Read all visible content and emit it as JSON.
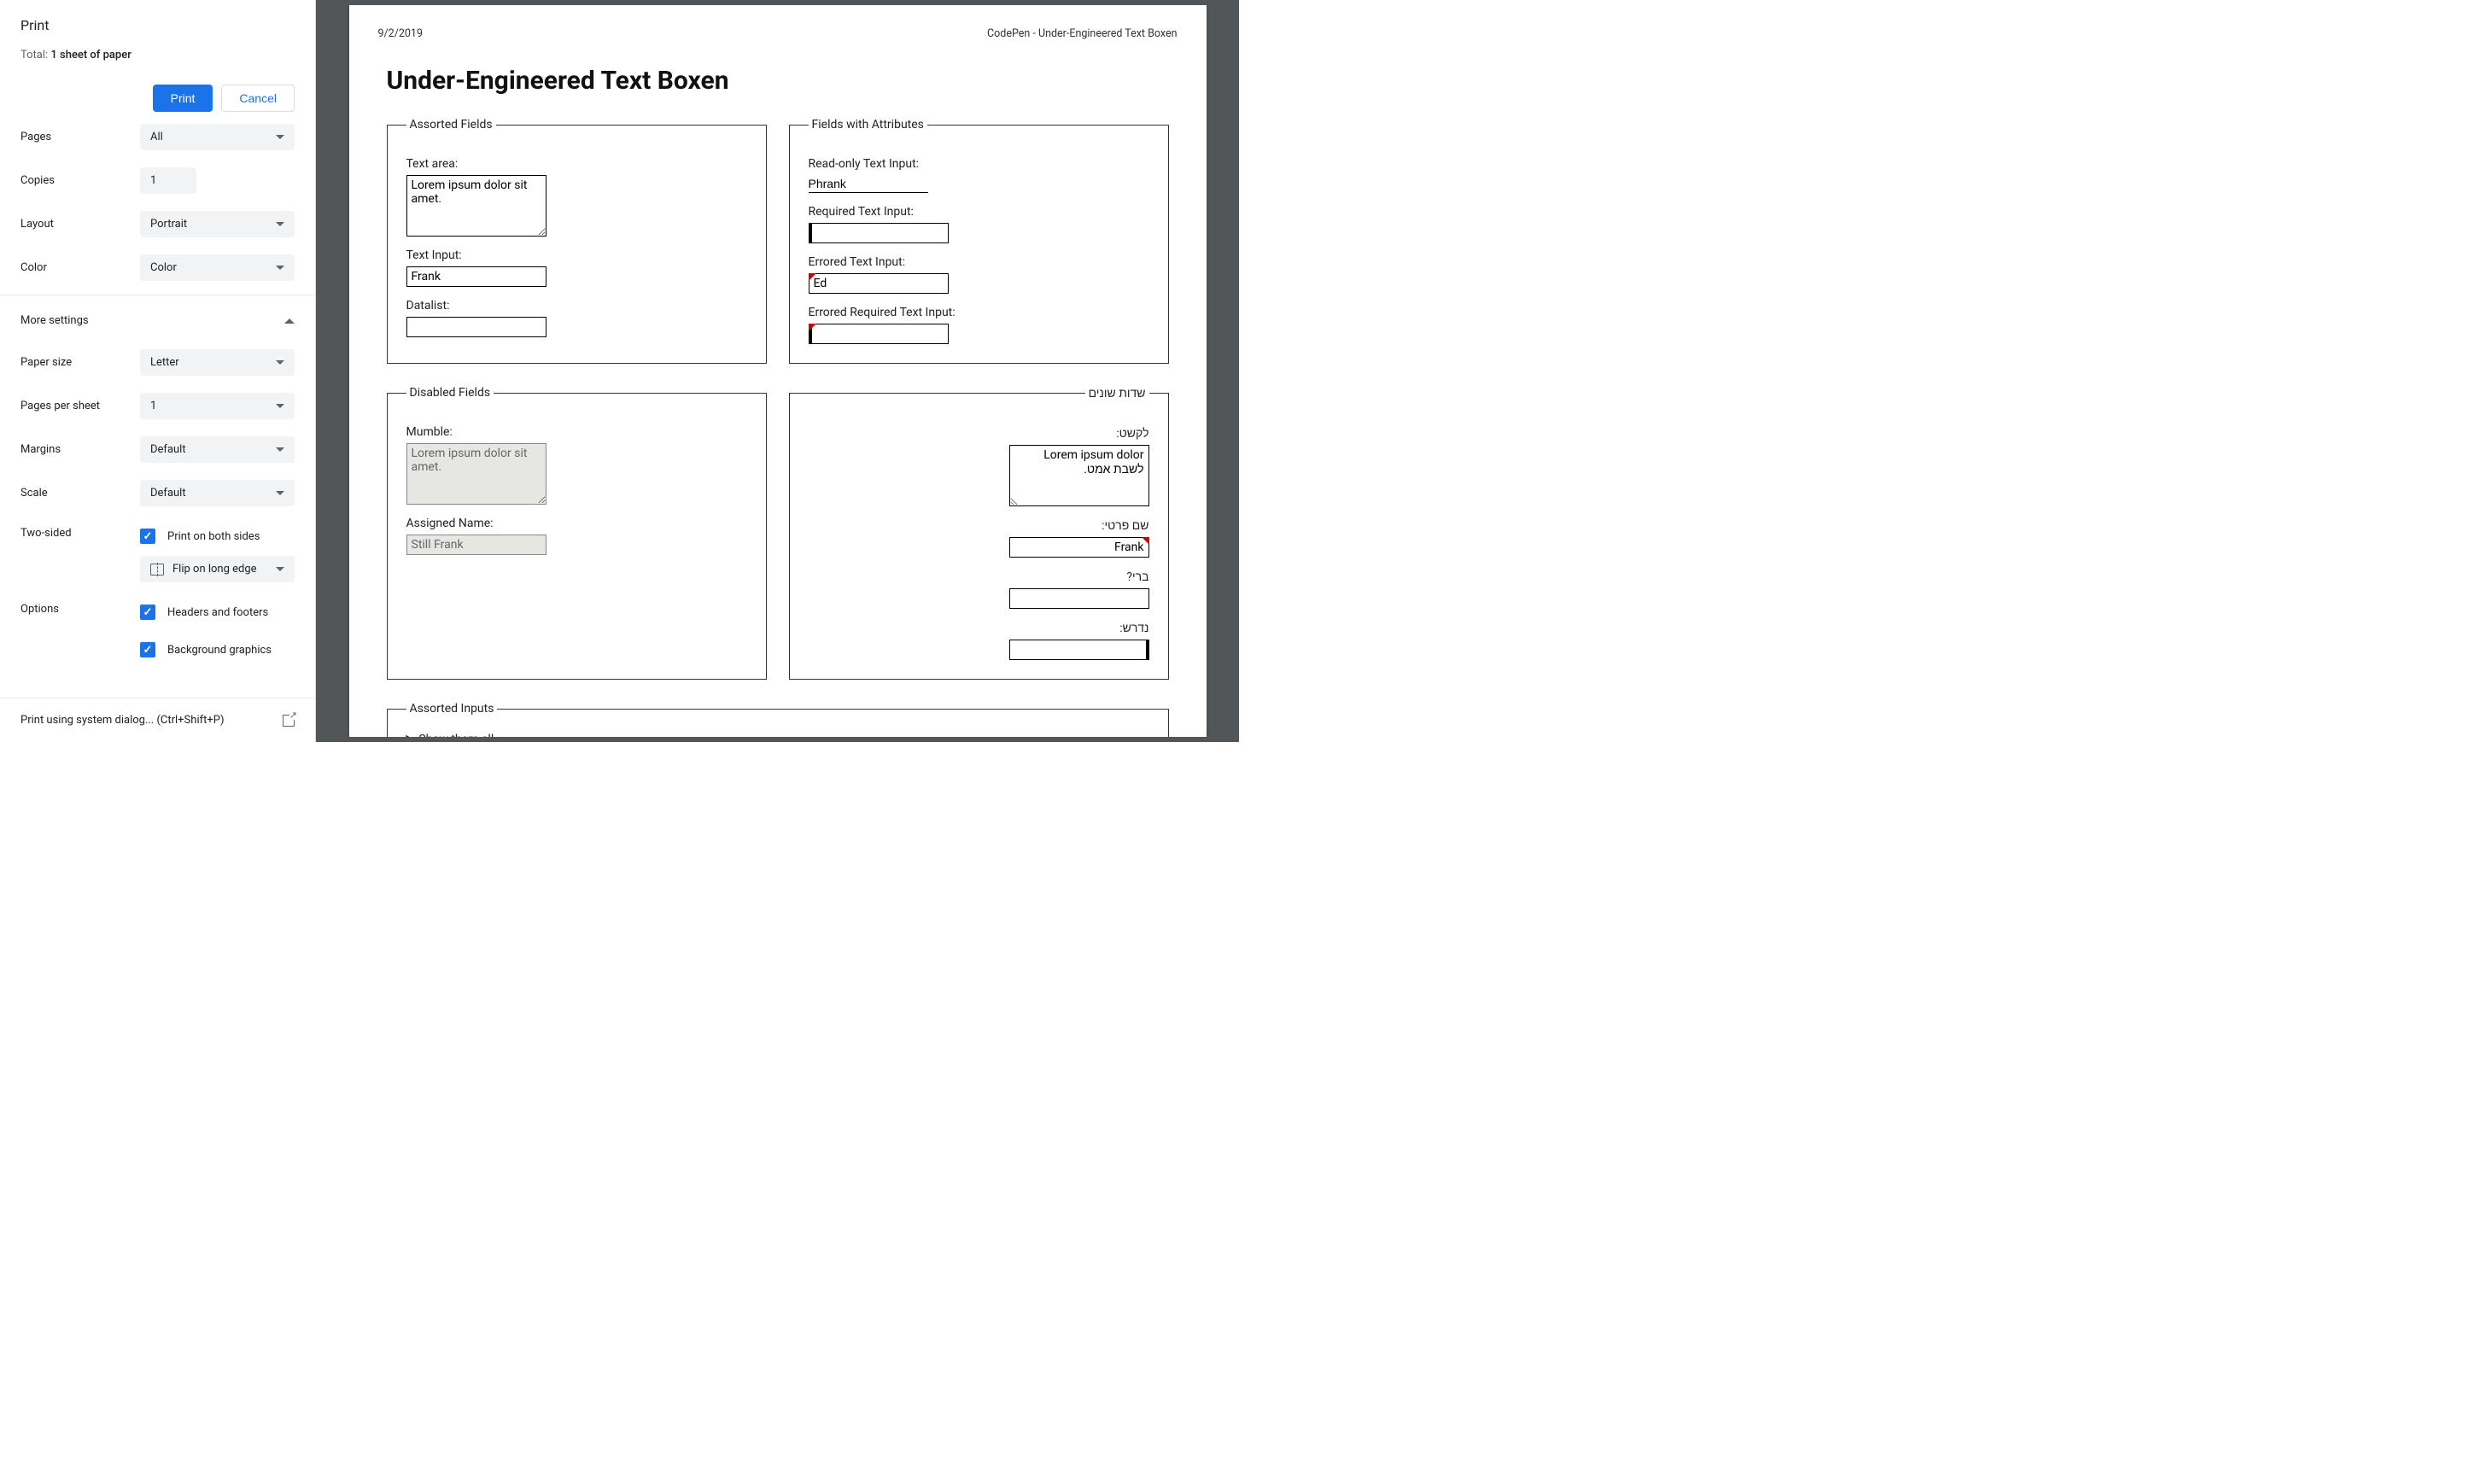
{
  "sidebar": {
    "title": "Print",
    "total_prefix": "Total: ",
    "total_value": "1 sheet of paper",
    "print_btn": "Print",
    "cancel_btn": "Cancel",
    "rows": {
      "pages": {
        "label": "Pages",
        "value": "All"
      },
      "copies": {
        "label": "Copies",
        "value": "1"
      },
      "layout": {
        "label": "Layout",
        "value": "Portrait"
      },
      "color": {
        "label": "Color",
        "value": "Color"
      },
      "more": {
        "label": "More settings"
      },
      "paper": {
        "label": "Paper size",
        "value": "Letter"
      },
      "pps": {
        "label": "Pages per sheet",
        "value": "1"
      },
      "margins": {
        "label": "Margins",
        "value": "Default"
      },
      "scale": {
        "label": "Scale",
        "value": "Default"
      },
      "two_sided": {
        "label": "Two-sided",
        "check_label": "Print on both sides",
        "duplex": "Flip on long edge"
      },
      "options": {
        "label": "Options",
        "hf": "Headers and footers",
        "bg": "Background graphics"
      }
    },
    "footer": {
      "text": "Print using system dialog... (Ctrl+Shift+P)"
    }
  },
  "preview": {
    "date": "9/2/2019",
    "doc_title": "CodePen - Under-Engineered Text Boxen",
    "heading": "Under-Engineered Text Boxen",
    "fieldsets": {
      "assorted": {
        "legend": "Assorted Fields",
        "textarea_label": "Text area:",
        "textarea_value": "Lorem ipsum dolor sit amet.",
        "textinput_label": "Text Input:",
        "textinput_value": "Frank",
        "datalist_label": "Datalist:",
        "datalist_value": ""
      },
      "attrib": {
        "legend": "Fields with Attributes",
        "readonly_label": "Read-only Text Input:",
        "readonly_value": "Phrank",
        "required_label": "Required Text Input:",
        "required_value": "",
        "errored_label": "Errored Text Input:",
        "errored_value": "Ed",
        "err_req_label": "Errored Required Text Input:",
        "err_req_value": ""
      },
      "disabled": {
        "legend": "Disabled Fields",
        "mumble_label": "Mumble:",
        "mumble_value": "Lorem ipsum dolor sit amet.",
        "assigned_label": "Assigned Name:",
        "assigned_value": "Still Frank"
      },
      "rtl": {
        "legend": "שדות שונים",
        "ta_label": "לקשט:",
        "ta_value": "Lorem ipsum dolor לשבת אמט.",
        "name_label": "שם פרטי:",
        "name_value": "Frank",
        "bri_label": "ברי?",
        "bri_value": "",
        "req_label": "נדרש:",
        "req_value": ""
      },
      "inputs": {
        "legend": "Assorted Inputs",
        "summary": "Show them all"
      }
    }
  }
}
